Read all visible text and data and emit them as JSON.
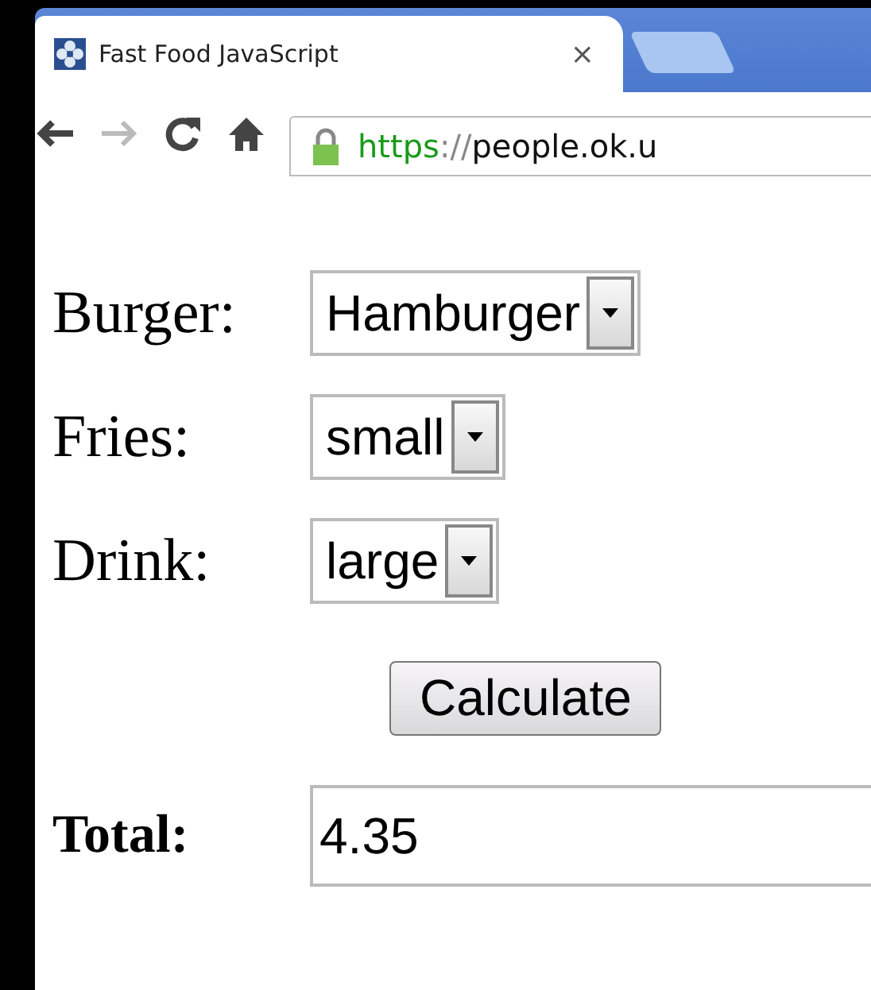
{
  "browser": {
    "tab": {
      "title": "Fast Food JavaScript",
      "close": "×"
    },
    "address": {
      "scheme": "https",
      "separator": "://",
      "rest": "people.ok.u"
    }
  },
  "form": {
    "fields": [
      {
        "label": "Burger:",
        "value": "Hamburger"
      },
      {
        "label": "Fries:",
        "value": "small"
      },
      {
        "label": "Drink:",
        "value": "large"
      }
    ],
    "button": "Calculate",
    "total": {
      "label": "Total:",
      "value": "4.35"
    }
  }
}
